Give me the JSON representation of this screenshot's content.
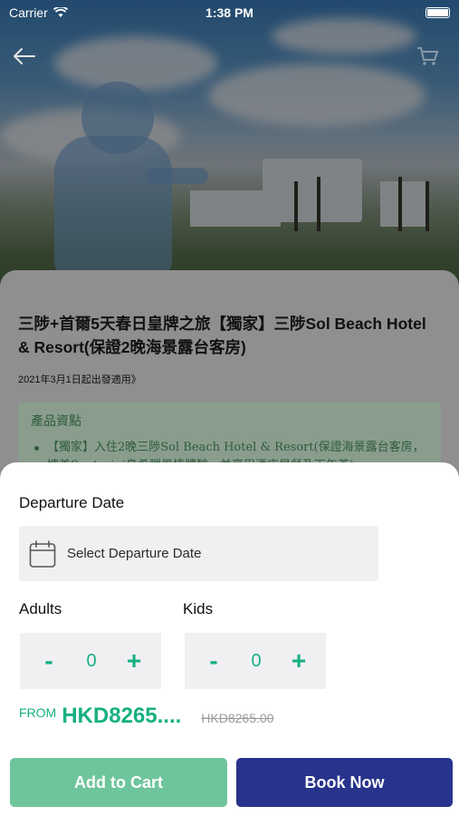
{
  "status_bar": {
    "carrier": "Carrier",
    "time": "1:38 PM"
  },
  "nav": {
    "back_icon": "arrow-left-icon",
    "cart_icon": "cart-icon"
  },
  "product": {
    "title": "三陟+首爾5天春日皇牌之旅【獨家】三陟Sol Beach Hotel & Resort(保證2晚海景露台客房)",
    "subtitle": "2021年3月1日起出發適用》",
    "info_heading": "產品資點",
    "info_bullet": "【獨家】入住2晚三陟Sol Beach Hotel & Resort(保證海景露台客房，媲美Santorini島希臘風情體驗，並享用酒店早餐及下午茶)"
  },
  "booking": {
    "departure_label": "Departure Date",
    "date_placeholder": "Select Departure Date",
    "adults_label": "Adults",
    "kids_label": "Kids",
    "adults_value": "0",
    "kids_value": "0",
    "minus": "-",
    "plus": "+",
    "from_label": "FROM",
    "price": "HKD8265....",
    "original_price": "HKD8265.00",
    "add_to_cart": "Add to Cart",
    "book_now": "Book Now"
  },
  "colors": {
    "accent": "#16b080",
    "primary": "#28338c",
    "cart_button": "#6fc59b"
  }
}
